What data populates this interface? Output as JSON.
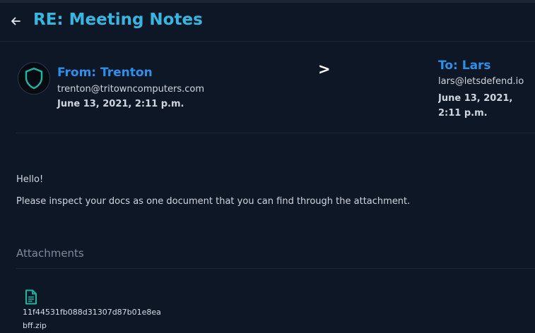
{
  "header": {
    "title": "RE: Meeting Notes"
  },
  "sender": {
    "name_label": "From: Trenton",
    "email": "trenton@tritowncomputers.com",
    "date": "June 13, 2021, 2:11 p.m."
  },
  "arrow": ">",
  "recipient": {
    "name_label": "To: Lars",
    "email": "lars@letsdefend.io",
    "date": "June 13, 2021, 2:11 p.m."
  },
  "body": {
    "greeting": "Hello!",
    "text": "Please inspect your docs as one document that you can find through the attachment."
  },
  "attachments": {
    "heading": "Attachments",
    "items": [
      {
        "hash": "11f44531fb088d31307d87b01e8ea",
        "filename": "bff.zip",
        "icon": "file-icon"
      }
    ]
  },
  "colors": {
    "background": "#0e1726",
    "title": "#38b6e0",
    "name_link": "#2e8fea",
    "accent_teal": "#1fb5a3"
  }
}
